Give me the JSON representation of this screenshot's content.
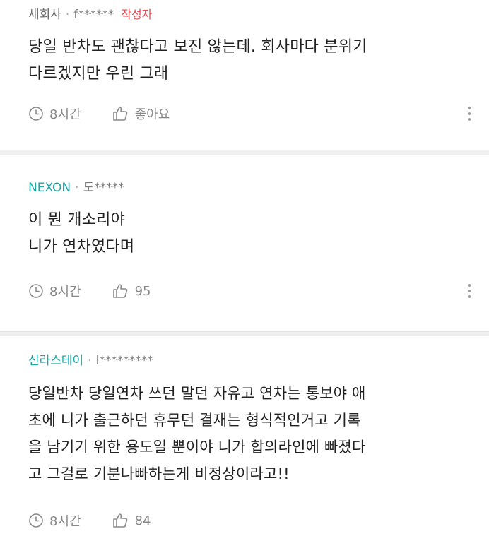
{
  "comments": [
    {
      "company": "새회사",
      "user": "f******",
      "badge": "작성자",
      "body": "당일 반차도 괜찮다고 보진 않는데. 회사마다 분위기\n다르겠지만 우린 그래",
      "time": "8시간",
      "likes": "좋아요"
    },
    {
      "company": "NEXON",
      "user": "도*****",
      "body": "이 뭔 개소리야\n니가 연차였다며",
      "time": "8시간",
      "likes": "95"
    },
    {
      "company": "신라스테이",
      "user": "l*********",
      "body": "당일반차 당일연차 쓰던 말던 자유고 연차는 통보야 애\n초에 니가 출근하던 휴무던 결재는 형식적인거고 기록\n을 남기기 위한 용도일 뿐이야 니가 합의라인에 빠졌다\n고 그걸로 기분나빠하는게 비정상이라고!!",
      "time": "8시간",
      "likes": "84"
    }
  ],
  "colors": {
    "brand_company": "#19a7a0",
    "author_badge": "#e5484d",
    "muted": "#888888"
  },
  "icons": {
    "time": "clock-icon",
    "like": "thumbs-up-icon",
    "more": "more-vertical-icon"
  }
}
